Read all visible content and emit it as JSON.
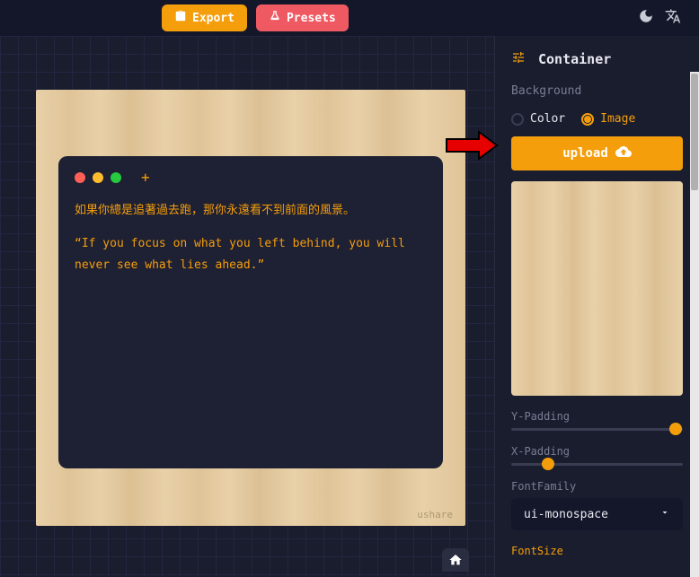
{
  "topbar": {
    "export_label": "Export",
    "presets_label": "Presets"
  },
  "code_window": {
    "line1": "如果你總是追著過去跑，那你永遠看不到前面的風景。",
    "line2": "“If you focus on what you left behind, you will never see what lies ahead.”"
  },
  "watermark": "ushare",
  "sidebar": {
    "title": "Container",
    "background_label": "Background",
    "bg_options": {
      "color": "Color",
      "image": "Image"
    },
    "upload_label": "upload",
    "y_padding_label": "Y-Padding",
    "x_padding_label": "X-Padding",
    "font_family_label": "FontFamily",
    "font_family_value": "ui-monospace",
    "font_size_label": "FontSize"
  },
  "sliders": {
    "y_padding_percent": 92,
    "x_padding_percent": 18
  }
}
